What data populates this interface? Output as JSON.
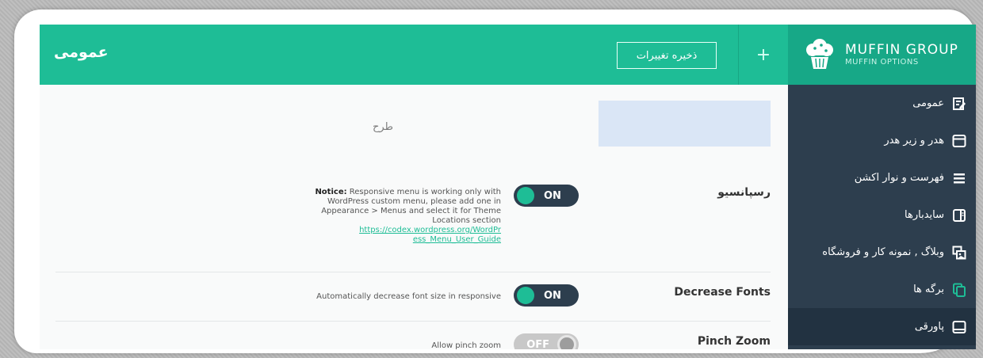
{
  "header": {
    "title": "عمومی",
    "save_label": "ذخیره تغییرات",
    "plus_label": "+",
    "logo_name": "MUFFIN GROUP",
    "logo_sub": "MUFFIN OPTIONS"
  },
  "sidebar": {
    "items": [
      {
        "label": "عمومی",
        "icon": "edit-note-icon"
      },
      {
        "label": "هدر و زیر هدر",
        "icon": "window-icon"
      },
      {
        "label": "فهرست و نوار اکشن",
        "icon": "menu-icon"
      },
      {
        "label": "سایدبارها",
        "icon": "sidebar-icon"
      },
      {
        "label": "وبلاگ , نمونه کار و فروشگاه",
        "icon": "gallery-icon"
      },
      {
        "label": "برگه ها",
        "icon": "pages-icon"
      },
      {
        "label": "پاورقی",
        "icon": "footer-icon"
      }
    ]
  },
  "content": {
    "section_title": "طرح",
    "rows": [
      {
        "label": "رسپانسیو",
        "toggle": "ON",
        "notice_bold": "Notice:",
        "notice_text": "Responsive menu is working only with WordPress custom menu, please add one in Appearance > Menus and select it for Theme Locations section",
        "link": "https://codex.wordpress.org/WordPress_Menu_User_Guide"
      },
      {
        "label": "Decrease Fonts",
        "toggle": "ON",
        "desc": "Automatically decrease font size in responsive"
      },
      {
        "label": "Pinch Zoom",
        "toggle": "OFF",
        "desc": "Allow pinch zoom"
      }
    ]
  },
  "colors": {
    "accent": "#1ebd96",
    "sidebar": "#2d3e4e",
    "placeholder": "#dae6f6"
  }
}
